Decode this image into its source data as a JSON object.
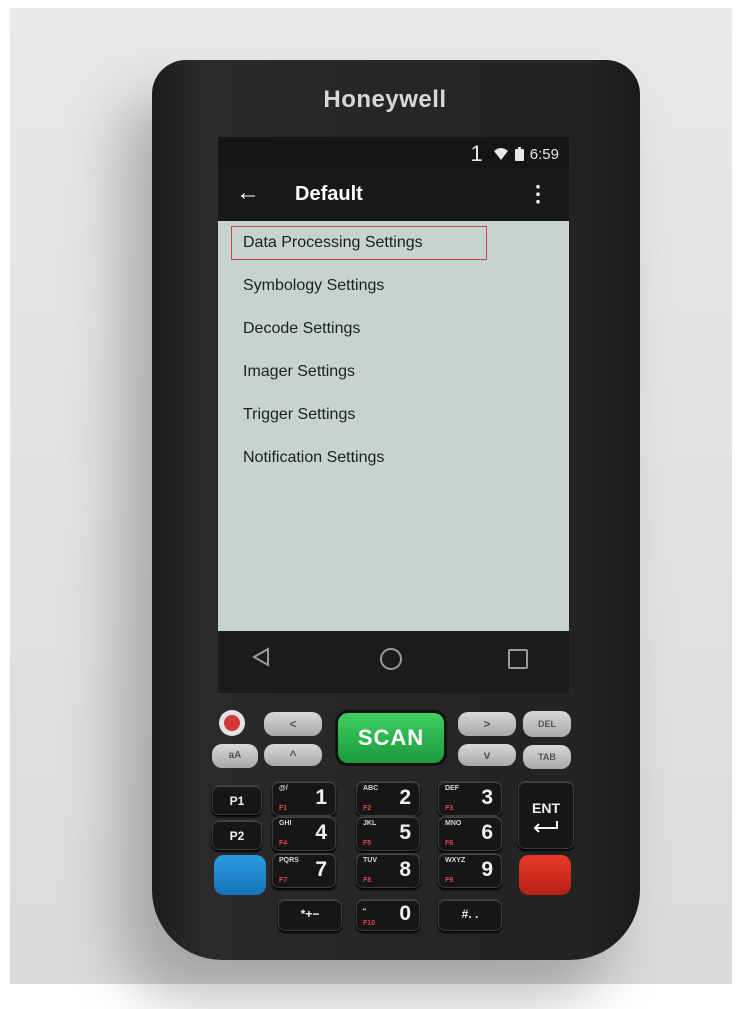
{
  "device": {
    "brand": "Honeywell"
  },
  "status": {
    "notification_count": "1",
    "time": "6:59",
    "wifi_icon": "wifi-icon",
    "battery_icon": "battery-icon"
  },
  "appbar": {
    "back_glyph": "←",
    "title": "Default",
    "menu_glyph": "⋮"
  },
  "list": {
    "items": [
      {
        "label": "Data Processing Settings",
        "highlighted": true
      },
      {
        "label": "Symbology Settings"
      },
      {
        "label": "Decode Settings"
      },
      {
        "label": "Imager Settings"
      },
      {
        "label": "Trigger Settings"
      },
      {
        "label": "Notification Settings"
      }
    ],
    "highlight_color": "#d23a3a"
  },
  "navbar": {
    "back_icon": "triangle-back-icon",
    "home_icon": "circle-home-icon",
    "recent_icon": "square-recents-icon"
  },
  "keypad": {
    "scan": "SCAN",
    "p1": "P1",
    "p2": "P2",
    "ent": "ENT",
    "del": "DEL",
    "tab": "TAB",
    "shift": "aA",
    "k1": {
      "sub": "@/",
      "fn": "F1",
      "num": "1"
    },
    "k2": {
      "sub": "ABC",
      "fn": "F2",
      "num": "2"
    },
    "k3": {
      "sub": "DEF",
      "fn": "F3",
      "num": "3"
    },
    "k4": {
      "sub": "GHI",
      "fn": "F4",
      "num": "4"
    },
    "k5": {
      "sub": "JKL",
      "fn": "F5",
      "num": "5"
    },
    "k6": {
      "sub": "MNO",
      "fn": "F6",
      "num": "6"
    },
    "k7": {
      "sub": "PQRS",
      "fn": "F7",
      "num": "7"
    },
    "k8": {
      "sub": "TUV",
      "fn": "F8",
      "num": "8"
    },
    "k9": {
      "sub": "WXYZ",
      "fn": "F9",
      "num": "9"
    },
    "k0": {
      "sub": "⎵",
      "fn": "F10",
      "num": "0"
    },
    "star": "*+−",
    "hash": "#. ."
  },
  "colors": {
    "scan_green": "#2bb34e",
    "blue_key": "#1e88d0",
    "red_key": "#d8301f",
    "screen_bg": "#c6d3d0"
  }
}
